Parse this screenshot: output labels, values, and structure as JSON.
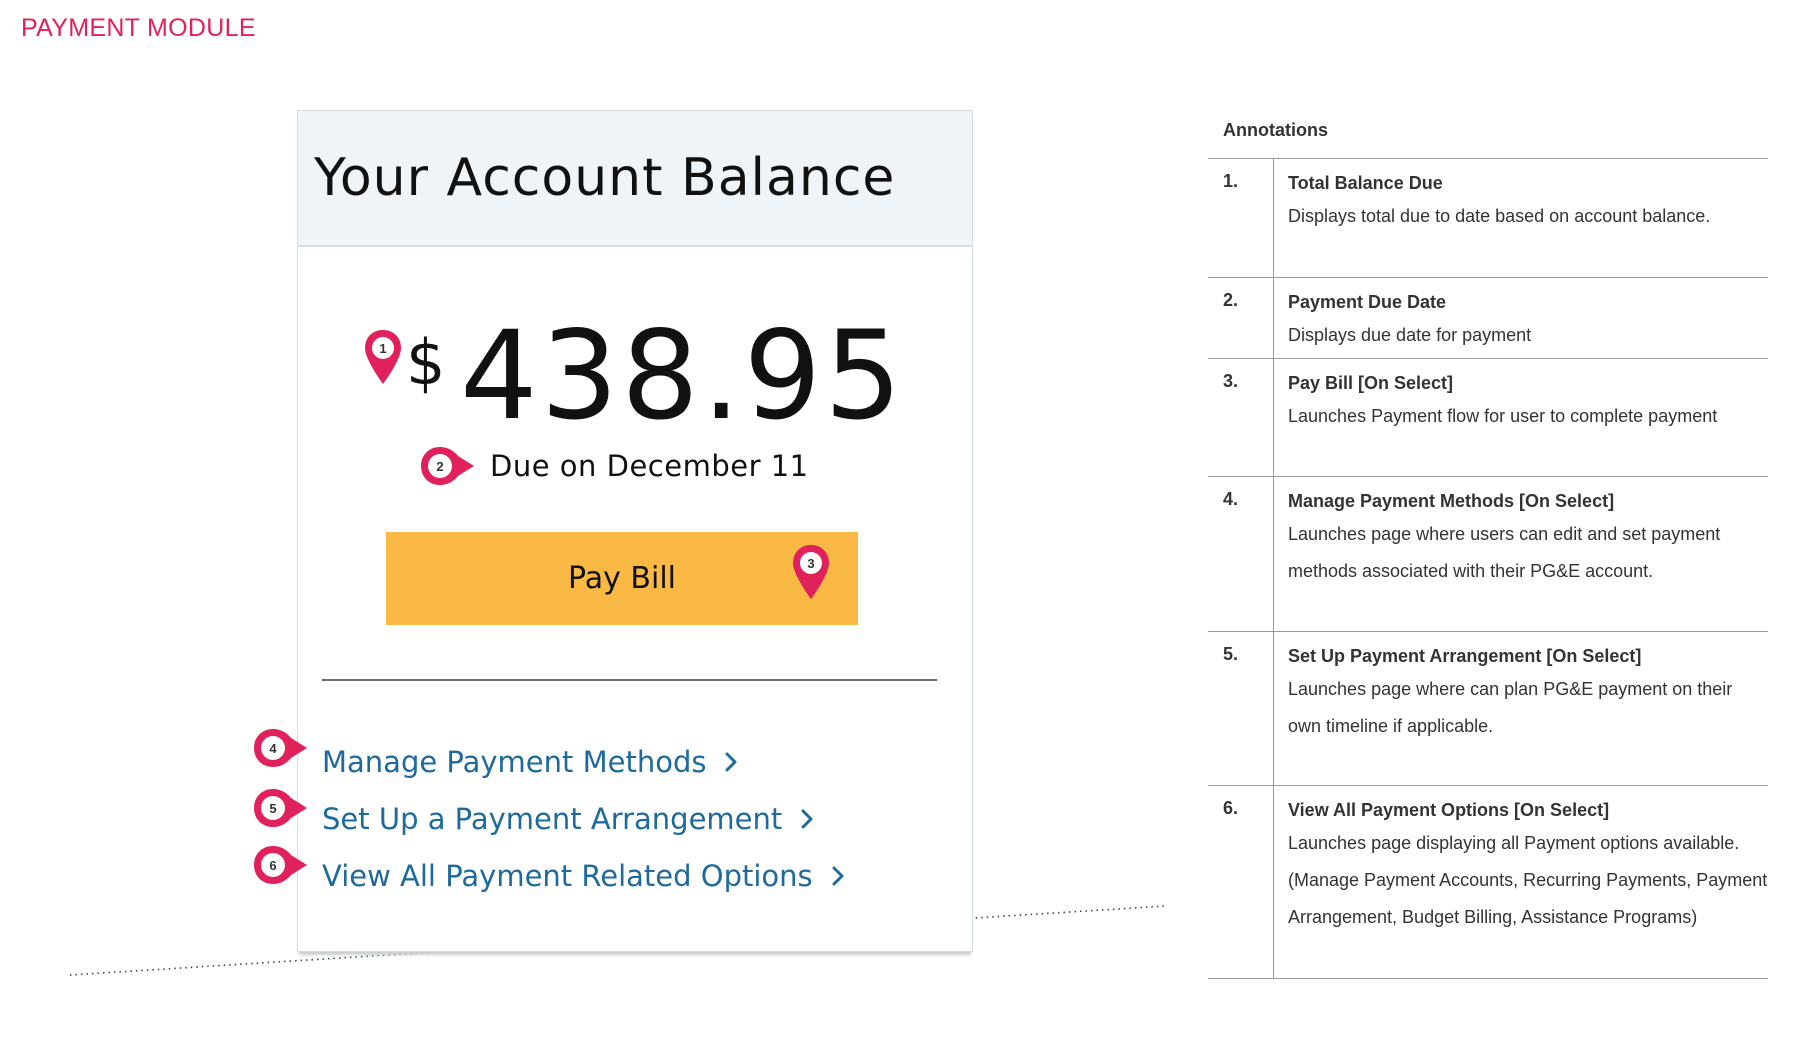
{
  "page": {
    "title": "PAYMENT MODULE"
  },
  "card": {
    "title": "Your Account Balance",
    "currency_symbol": "$",
    "amount": "438.95",
    "due_text": "Due on December 11",
    "pay_button_label": "Pay Bill",
    "links": [
      {
        "label": "Manage Payment Methods",
        "marker": "4"
      },
      {
        "label": "Set Up a Payment Arrangement",
        "marker": "5"
      },
      {
        "label": "View All Payment Related Options",
        "marker": "6"
      }
    ]
  },
  "markers": {
    "m1": "1",
    "m2": "2",
    "m3": "3"
  },
  "annotations": {
    "heading": "Annotations",
    "items": [
      {
        "num": "1.",
        "title": "Total Balance Due",
        "desc": "Displays total due to date based on account balance."
      },
      {
        "num": "2.",
        "title": "Payment Due Date",
        "desc": "Displays due date for payment"
      },
      {
        "num": "3.",
        "title": "Pay Bill [On Select]",
        "desc": "Launches Payment flow for user to complete payment"
      },
      {
        "num": "4.",
        "title": "Manage Payment Methods [On Select]",
        "desc": "Launches page where users can edit and set payment methods associated with their PG&E account."
      },
      {
        "num": "5.",
        "title": "Set Up Payment Arrangement [On Select]",
        "desc": "Launches page where can plan PG&E payment on their own timeline if applicable."
      },
      {
        "num": "6.",
        "title": "View All Payment Options [On Select]",
        "desc": "Launches page displaying all Payment options available. (Manage Payment Accounts, Recurring Payments, Payment Arrangement, Budget Billing, Assistance Programs)"
      }
    ]
  },
  "colors": {
    "accent": "#e0215c",
    "button": "#f9b944",
    "link": "#1e6a9c",
    "header_bg": "#eef4f8"
  }
}
